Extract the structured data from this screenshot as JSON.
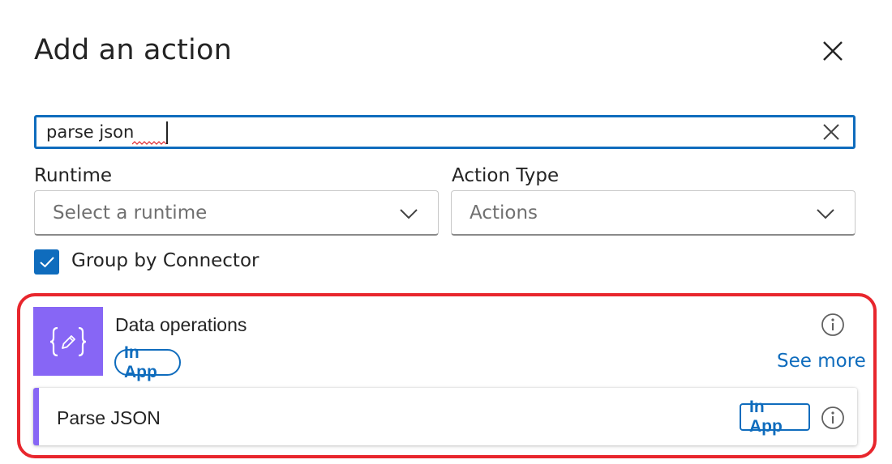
{
  "dialog": {
    "title": "Add an action"
  },
  "search": {
    "value": "parse json"
  },
  "filters": {
    "runtime_label": "Runtime",
    "runtime_placeholder": "Select a runtime",
    "action_type_label": "Action Type",
    "action_type_value": "Actions"
  },
  "group_by": {
    "label": "Group by Connector",
    "checked": true
  },
  "connector": {
    "name": "Data operations",
    "badge": "In App",
    "see_more": "See more",
    "icon": "curly-braces-pencil-icon",
    "icon_bg_color": "#8766f5"
  },
  "actions": [
    {
      "name": "Parse JSON",
      "badge": "In App"
    }
  ],
  "colors": {
    "accent": "#0f6cbd",
    "highlight": "#e8262d"
  }
}
